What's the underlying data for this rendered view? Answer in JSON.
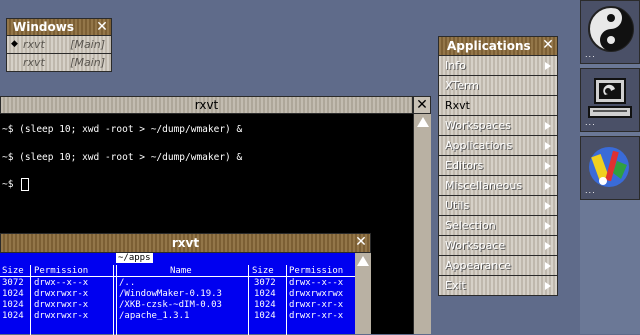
{
  "windows_menu": {
    "title": "Windows",
    "items": [
      {
        "marker": "◆",
        "name": "rxvt",
        "tag": "[Main]"
      },
      {
        "marker": "",
        "name": "rxvt",
        "tag": "[Main]"
      }
    ]
  },
  "applications_menu": {
    "title": "Applications",
    "items": [
      {
        "label": "Info",
        "submenu": true
      },
      {
        "label": "XTerm",
        "submenu": false
      },
      {
        "label": "Rxvt",
        "submenu": false
      },
      {
        "label": "Workspaces",
        "submenu": true
      },
      {
        "label": "Applications",
        "submenu": true
      },
      {
        "label": "Editors",
        "submenu": true
      },
      {
        "label": "Miscellaneous",
        "submenu": true
      },
      {
        "label": "Utils",
        "submenu": true
      },
      {
        "label": "Selection",
        "submenu": true
      },
      {
        "label": "Workspace",
        "submenu": true
      },
      {
        "label": "Appearance",
        "submenu": true
      },
      {
        "label": "Exit",
        "submenu": true
      }
    ]
  },
  "terminal1": {
    "title": "rxvt",
    "lines": [
      "~$ (sleep 10; xwd -root > ~/dump/wmaker) &",
      "~$ (sleep 10; xwd -root > ~/dump/wmaker) &",
      "~$ "
    ]
  },
  "terminal2": {
    "title": "rxvt",
    "path": "~/apps",
    "left_headers": [
      "Size",
      "Permission"
    ],
    "right_headers": [
      "Name",
      "Size",
      "Permission"
    ],
    "left_rows": [
      [
        "3072",
        "drwx--x--x"
      ],
      [
        "1024",
        "drwxrwxr-x"
      ],
      [
        "1024",
        "drwxrwxr-x"
      ],
      [
        "1024",
        "drwxrwxr-x"
      ]
    ],
    "right_rows": [
      [
        "/..",
        "3072",
        "drwx--x--x"
      ],
      [
        "/WindowMaker-0.19.3",
        "1024",
        "drwxrwxrwx"
      ],
      [
        "/XKB-czsk-~dIM-0.03",
        "1024",
        "drwxr-xr-x"
      ],
      [
        "/apache_1.3.1",
        "1024",
        "drwxr-xr-x"
      ]
    ]
  },
  "dock": {
    "tiles": [
      "gnustep-logo-icon",
      "computer-monitor-icon",
      "paint-tools-icon"
    ]
  }
}
